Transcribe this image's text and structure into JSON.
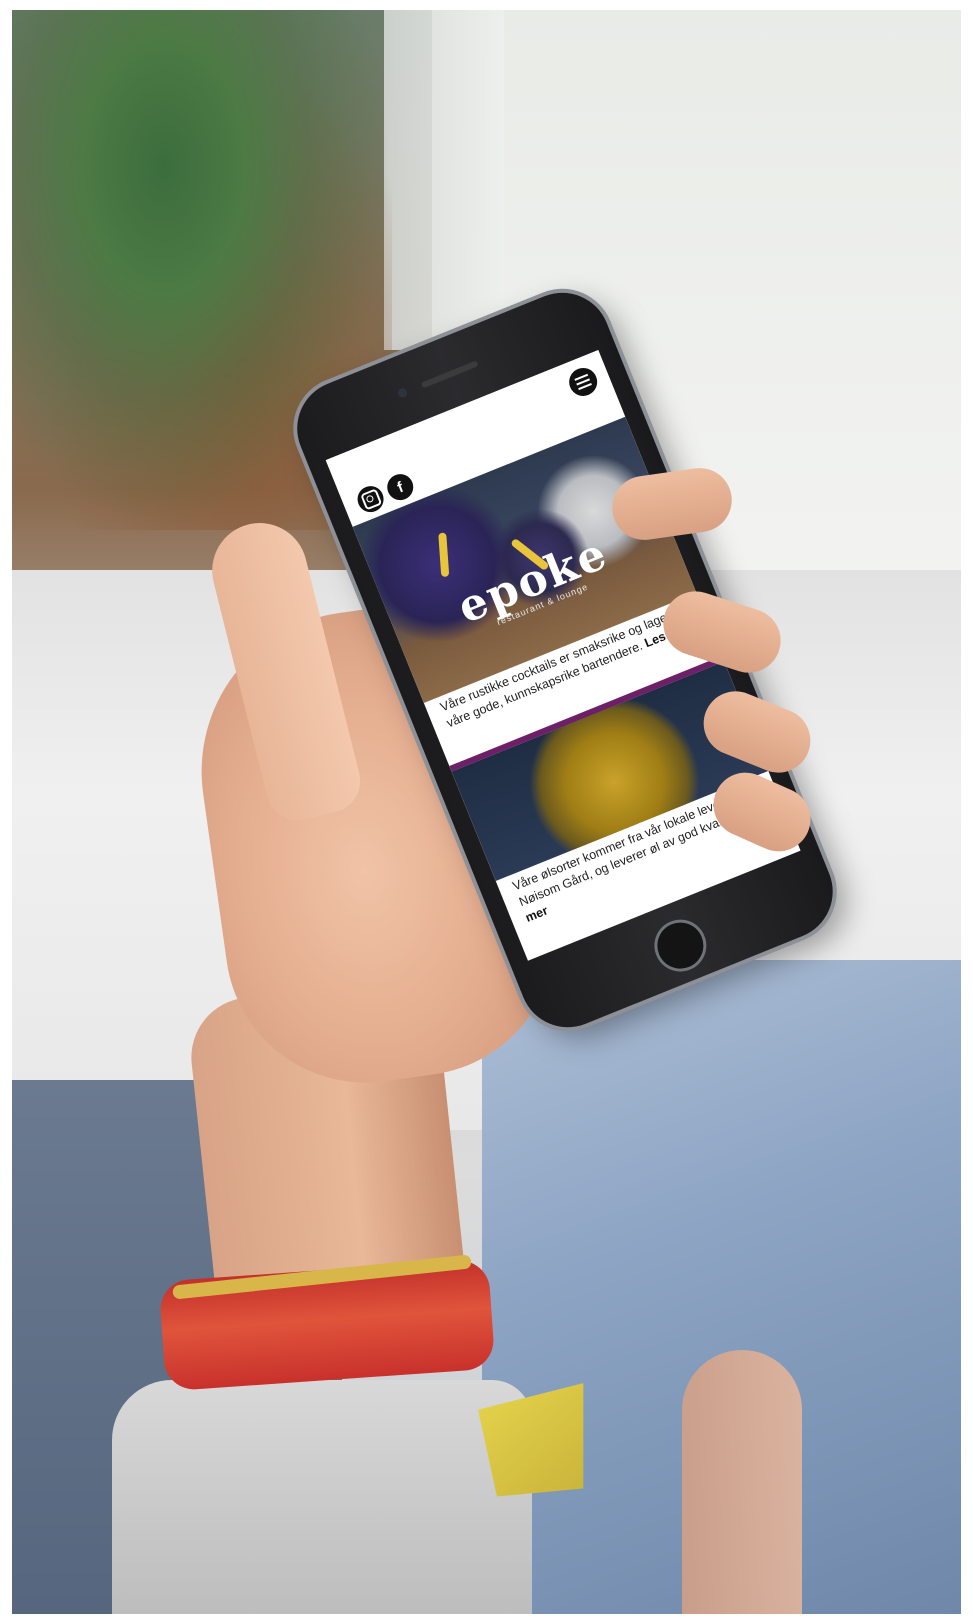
{
  "scene": {
    "description_tag": "hand-holding-phone-photo"
  },
  "phone_screen": {
    "logo": "epoke",
    "logo_tagline": "restaurant & lounge",
    "menu_icon": "hamburger-menu-icon",
    "social_icons": [
      "instagram-icon",
      "facebook-icon"
    ],
    "facebook_glyph": "f",
    "section1": {
      "text": "Våre rustikke cocktails er smaksrike og lages av våre gode, kunnskapsrike bartendere.",
      "link": "Les mer"
    },
    "section2": {
      "text": "Våre ølsorter kommer fra vår lokale leverandør Nøisom Gård, og leverer øl av god kvalitet.",
      "link": "Les mer"
    },
    "accent_color": "#6d1f68"
  }
}
